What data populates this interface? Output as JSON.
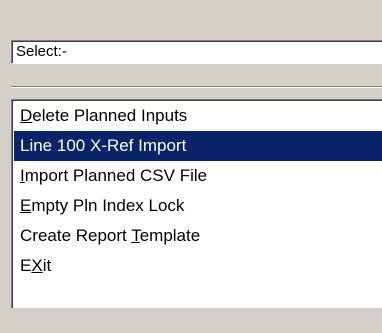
{
  "combo": {
    "value": "Select:-"
  },
  "list": {
    "items": [
      {
        "pre": "",
        "mn": "D",
        "post": "elete Planned Inputs",
        "selected": false
      },
      {
        "pre": "Line 100 X-Ref Import",
        "mn": "",
        "post": "",
        "selected": true
      },
      {
        "pre": "",
        "mn": "I",
        "post": "mport Planned CSV File",
        "selected": false
      },
      {
        "pre": "",
        "mn": "E",
        "post": "mpty Pln Index Lock",
        "selected": false
      },
      {
        "pre": "Create Report ",
        "mn": "T",
        "post": "emplate",
        "selected": false
      },
      {
        "pre": "E",
        "mn": "X",
        "post": "it",
        "selected": false
      }
    ]
  },
  "colors": {
    "window_bg": "#d4d0c8",
    "selection_bg": "#0a246a",
    "selection_text": "#ffffff"
  }
}
